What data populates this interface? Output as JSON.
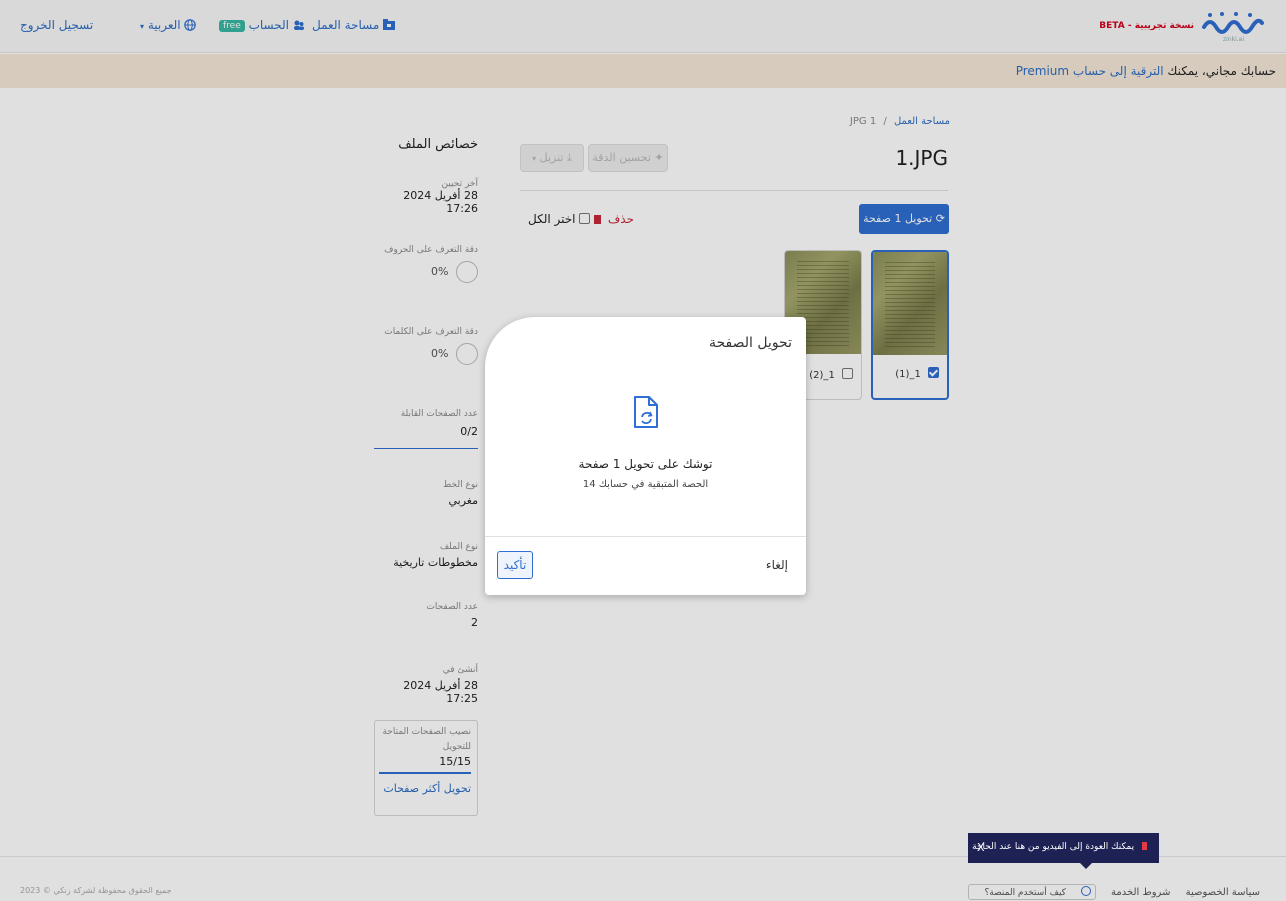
{
  "header": {
    "brand": "zinki.ai",
    "beta_badge": "نسخة تجريبية - BETA",
    "workspace": "مساحة العمل",
    "account": "الحساب",
    "free_badge": "free",
    "language": "العربية",
    "logout": "تسجيل الخروج"
  },
  "banner": {
    "text": "حسابك مجاني، يمكنك ",
    "link": "الترقية إلى حساب Premium"
  },
  "breadcrumb": {
    "link": "مساحة العمل",
    "separator": "/",
    "current": "JPG 1"
  },
  "file": {
    "title": "1.JPG"
  },
  "toolbar": {
    "enhance": "تحسين الدقة",
    "download": "تنزيل",
    "convert": "تحويل 1 صفحة",
    "delete": "حذف",
    "select_all": "اختر الكل"
  },
  "pages": [
    {
      "label": "1_(1)",
      "selected": true
    },
    {
      "label": "1_(2)",
      "selected": false
    }
  ],
  "properties": {
    "title": "خصائص الملف",
    "last_update_label": "آخر تحيين",
    "last_update_value": "28 أفريل 2024 17:26",
    "char_accuracy_label": "دقة التعرف على الحروف",
    "char_accuracy_value": "0%",
    "word_accuracy_label": "دقة التعرف على الكلمات",
    "word_accuracy_value": "0%",
    "editable_pages_label": "عدد الصفحات القابلة",
    "editable_pages_value": "0/2",
    "script_type_label": "نوع الخط",
    "script_type_value": "مغربي",
    "file_type_label": "نوع الملف",
    "file_type_value": "مخطوطات تاريخية",
    "page_count_label": "عدد الصفحات",
    "page_count_value": "2",
    "created_label": "أنشئ في",
    "created_value": "28 أفريل 2024 17:25",
    "quota_label_1": "نصيب الصفحات المتاحة",
    "quota_label_2": "للتحويل",
    "quota_value": "15/15",
    "quota_link": "تحويل أكثر صفحات"
  },
  "modal": {
    "title": "تحويل الصفحة",
    "message": "توشك على تحويل 1 صفحة",
    "sub": "الحصة المتبقية في حسابك 14",
    "cancel": "إلغاء",
    "confirm": "تأكيد"
  },
  "footer": {
    "privacy": "سياسة الخصوصية",
    "terms": "شروط الخدمة",
    "howto": "كيف أستخدم المنصة؟",
    "copyright": "جميع الحقوق محفوظة لشركة زنكي © 2023"
  },
  "toast": {
    "text": "يمكنك العودة إلى الفيديو من هنا عند الحاجة",
    "close": "X"
  },
  "colors": {
    "accent": "#2f6fd3",
    "banner": "#f5e8d8",
    "toast": "#1d2154",
    "delete": "#c6283a"
  }
}
